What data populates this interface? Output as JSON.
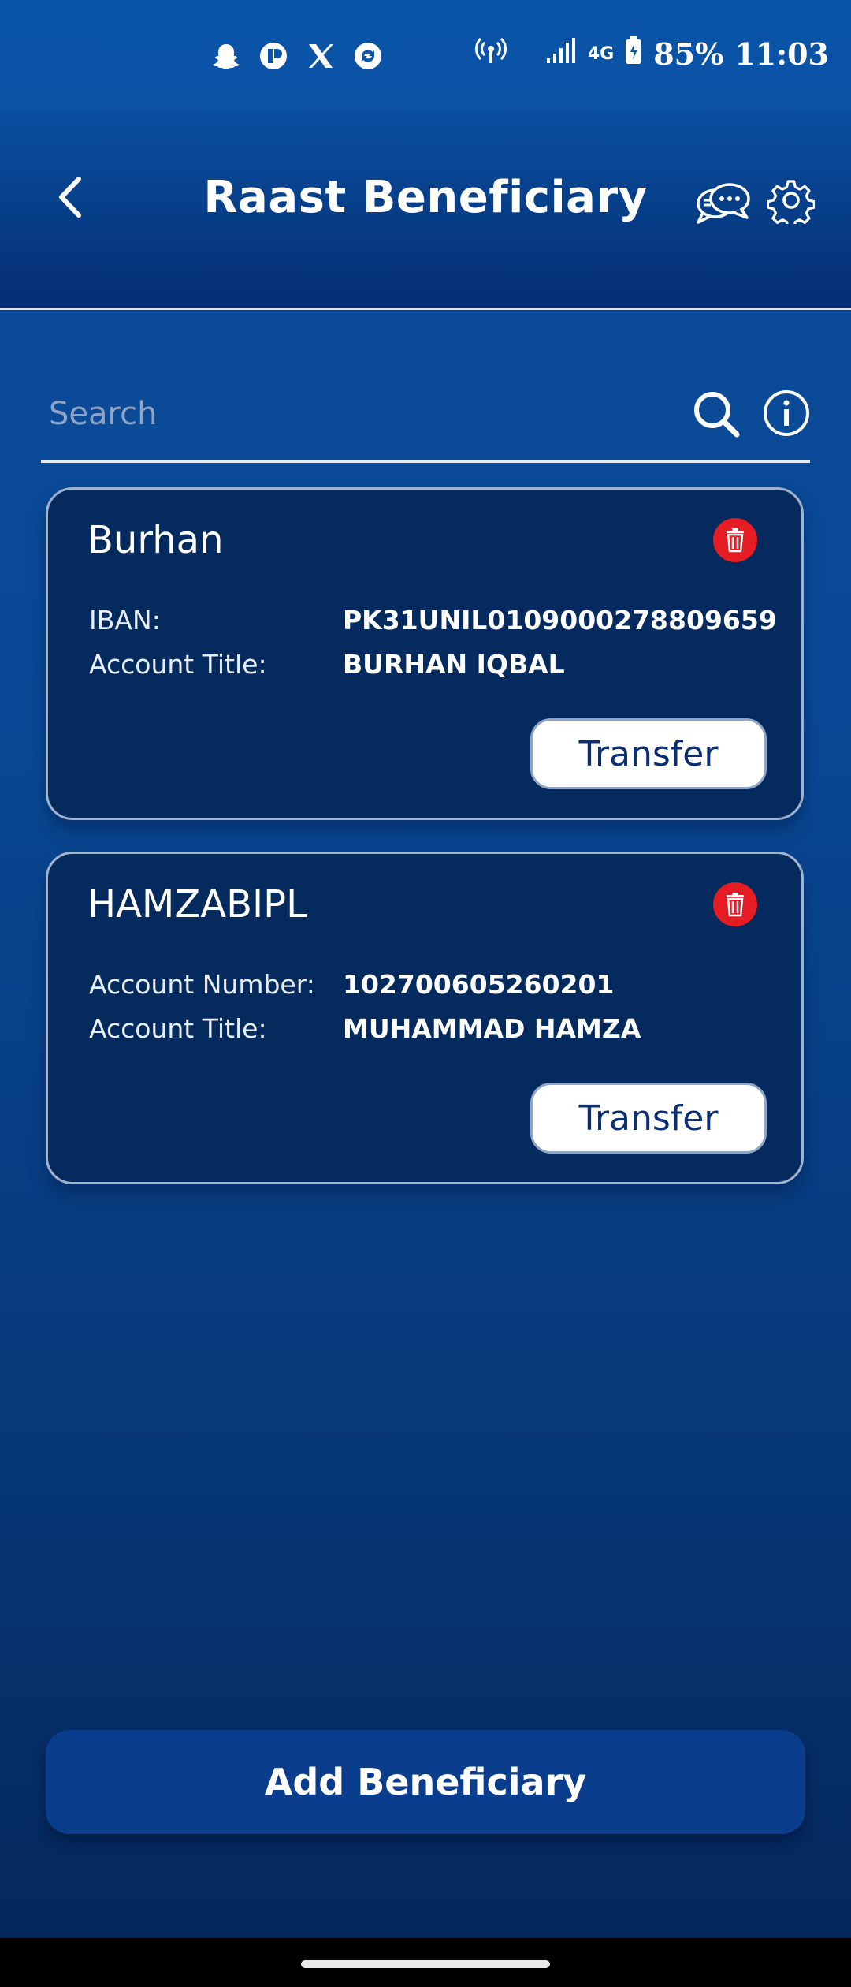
{
  "status_bar": {
    "left_icons": [
      "snapchat-icon",
      "app-icon",
      "x-icon",
      "refresh-app-icon"
    ],
    "network": "4G",
    "battery": "85%",
    "time": "11:03"
  },
  "header": {
    "title": "Raast Beneficiary"
  },
  "search": {
    "placeholder": "Search"
  },
  "beneficiaries": [
    {
      "name": "Burhan",
      "field1_label": "IBAN:",
      "field1_value": "PK31UNIL0109000278809659",
      "field2_label": "Account Title:",
      "field2_value": "BURHAN IQBAL",
      "action": "Transfer"
    },
    {
      "name": "HAMZABIPL",
      "field1_label": "Account Number:",
      "field1_value": "102700605260201",
      "field2_label": "Account Title:",
      "field2_value": "MUHAMMAD HAMZA",
      "action": "Transfer"
    }
  ],
  "footer": {
    "add_button": "Add Beneficiary"
  },
  "colors": {
    "primary": "#0b4a98",
    "card": "#052a5d",
    "delete": "#e51c23",
    "button_text": "#0b2f72"
  }
}
